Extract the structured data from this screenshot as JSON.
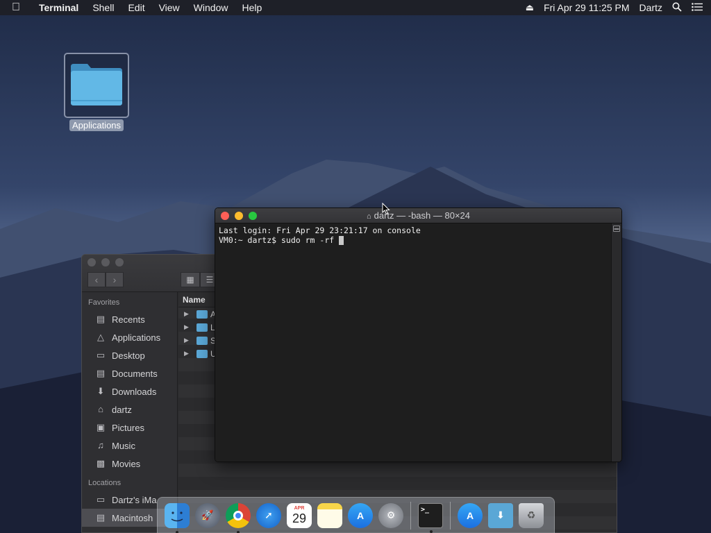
{
  "menubar": {
    "app_name": "Terminal",
    "menus": [
      "Shell",
      "Edit",
      "View",
      "Window",
      "Help"
    ],
    "datetime": "Fri Apr 29  11:25 PM",
    "user": "Dartz"
  },
  "desktop": {
    "icon_label": "Applications"
  },
  "terminal": {
    "title": "dartz — -bash — 80×24",
    "lines": [
      "Last login: Fri Apr 29 23:21:17 on console",
      "VM0:~ dartz$ sudo rm -rf "
    ]
  },
  "finder": {
    "sidebar": {
      "favorites_label": "Favorites",
      "favorites": [
        "Recents",
        "Applications",
        "Desktop",
        "Documents",
        "Downloads",
        "dartz",
        "Pictures",
        "Music",
        "Movies"
      ],
      "locations_label": "Locations",
      "locations": [
        "Dartz's iMa",
        "Macintosh"
      ]
    },
    "column_header": "Name",
    "rows": [
      "A",
      "L",
      "S",
      "U"
    ]
  },
  "dock": {
    "apps": [
      "finder",
      "launchpad",
      "chrome",
      "safari",
      "calendar",
      "notes",
      "app-store",
      "system-preferences",
      "terminal",
      "app-store-folder",
      "downloads-folder",
      "trash"
    ],
    "calendar_month": "APR",
    "calendar_day": "29"
  },
  "colors": {
    "traffic_red": "#fe5f57",
    "traffic_yellow": "#febc2e",
    "traffic_green": "#28c840",
    "terminal_bg": "#1e1e1e",
    "folder_blue": "#5aa7d6"
  }
}
